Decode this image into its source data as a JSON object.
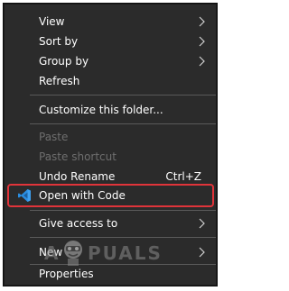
{
  "menu": {
    "items": [
      {
        "label": "View"
      },
      {
        "label": "Sort by"
      },
      {
        "label": "Group by"
      },
      {
        "label": "Refresh"
      },
      {
        "label": "Customize this folder..."
      },
      {
        "label": "Paste"
      },
      {
        "label": "Paste shortcut"
      },
      {
        "label": "Undo Rename",
        "shortcut": "Ctrl+Z"
      },
      {
        "label": "Open with Code",
        "icon": "vscode-icon"
      },
      {
        "label": "Give access to"
      },
      {
        "label": "New"
      },
      {
        "label": "Properties"
      }
    ]
  },
  "watermark": {
    "left": "A",
    "right": "PUALS"
  },
  "colors": {
    "menu_bg": "#2b2b2b",
    "highlight": "#e0343a",
    "disabled_text": "#6e6e6e",
    "vscode_blue": "#2a8de0"
  }
}
